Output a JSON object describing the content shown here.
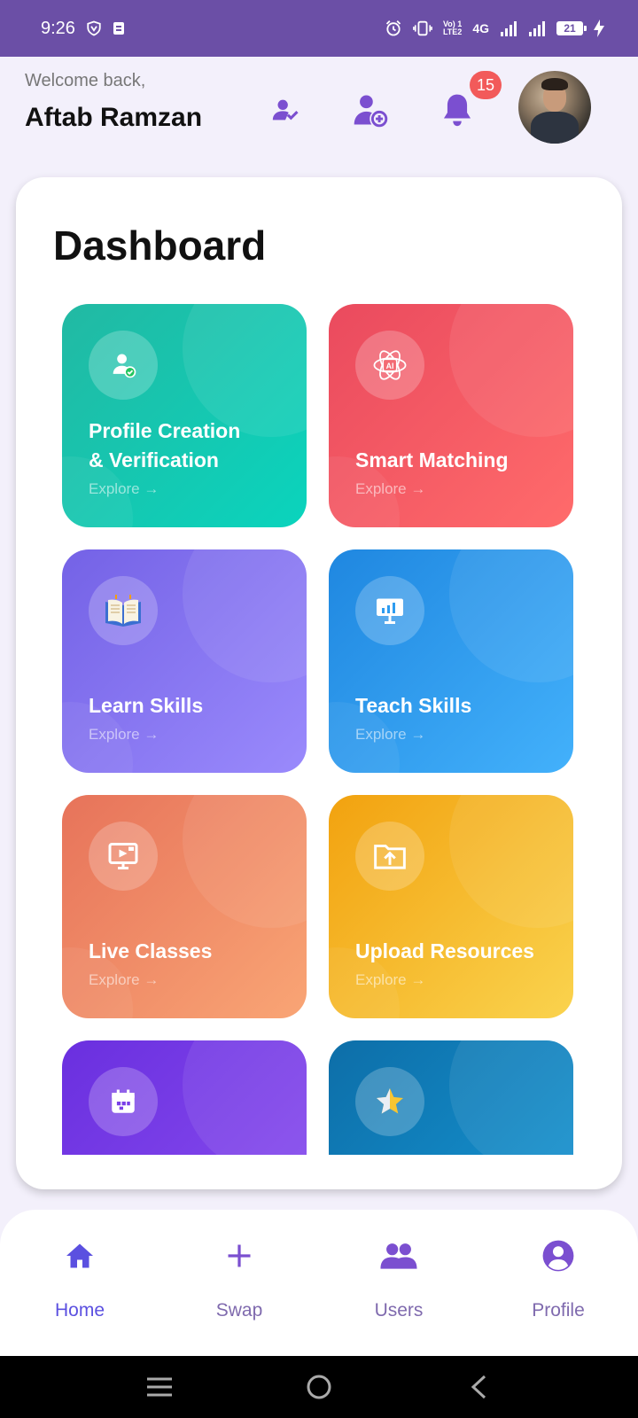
{
  "status_bar": {
    "time": "9:26",
    "network_label_top": "Vo) 1",
    "network_label_bottom": "LTE2",
    "network_type": "4G",
    "battery": "21"
  },
  "header": {
    "welcome": "Welcome back,",
    "user_name": "Aftab Ramzan",
    "notification_count": "15"
  },
  "dashboard": {
    "title": "Dashboard",
    "tiles": [
      {
        "line1": "Profile Creation",
        "line2": "& Verification",
        "explore": "Explore →",
        "icon": "user-verified-icon",
        "color": "#16c2ae"
      },
      {
        "line1": "Smart Matching",
        "explore": "Explore →",
        "icon": "ai-atom-icon",
        "color": "#f35b64"
      },
      {
        "line1": "Learn Skills",
        "explore": "Explore →",
        "icon": "open-book-icon",
        "color": "#8574f0"
      },
      {
        "line1": "Teach Skills",
        "explore": "Explore →",
        "icon": "presentation-board-icon",
        "color": "#2e9cf0"
      },
      {
        "line1": "Live Classes",
        "explore": "Explore →",
        "icon": "video-screen-icon",
        "color": "#ef8c68"
      },
      {
        "line1": "Upload Resources",
        "explore": "Explore →",
        "icon": "folder-upload-icon",
        "color": "#f6bb2e"
      },
      {
        "icon": "calendar-icon",
        "color": "#7a3fe8"
      },
      {
        "icon": "star-icon",
        "color": "#1184c0"
      }
    ]
  },
  "bottom_nav": {
    "items": [
      {
        "label": "Home",
        "icon": "home-icon",
        "active": true
      },
      {
        "label": "Swap",
        "icon": "plus-icon"
      },
      {
        "label": "Users",
        "icon": "users-icon"
      },
      {
        "label": "Profile",
        "icon": "profile-icon"
      }
    ]
  },
  "colors": {
    "status_bar": "#6b4fa6",
    "accent": "#7b4fd0",
    "nav_active": "#5b50e0",
    "badge": "#f25a5a"
  }
}
